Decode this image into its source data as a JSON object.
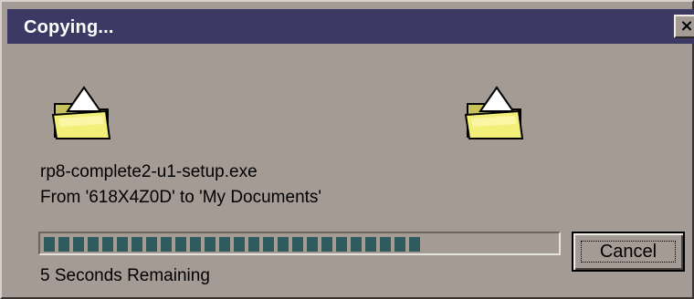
{
  "window": {
    "title": "Copying...",
    "close_label": "×"
  },
  "icons": {
    "source": "folder-icon",
    "destination": "folder-icon"
  },
  "file": {
    "name": "rp8-complete2-u1-setup.exe",
    "from_to": "From '618X4Z0D' to 'My Documents'"
  },
  "progress": {
    "fraction": 0.75,
    "remaining_text": "5 Seconds Remaining",
    "fill_color": "#2f5b5e"
  },
  "buttons": {
    "cancel_label": "Cancel"
  },
  "colors": {
    "title_bar": "#3c3a64",
    "dialog_bg": "#a59b95"
  }
}
